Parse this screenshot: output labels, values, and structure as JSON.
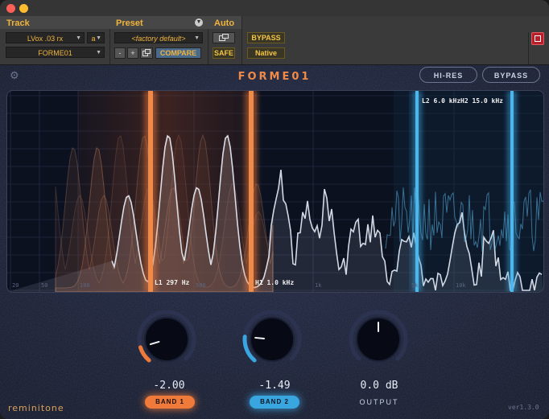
{
  "host": {
    "track_label": "Track",
    "track_name": "LVox .03 rx",
    "track_channel": "a",
    "plugin_instance": "FORME01",
    "preset_label": "Preset",
    "preset_name": "<factory default>",
    "minus_label": "-",
    "plus_label": "+",
    "compare_label": "COMPARE",
    "auto_label": "Auto",
    "safe_label": "SAFE",
    "bypass_label": "BYPASS",
    "native_label": "Native"
  },
  "plugin": {
    "title": "FORME01",
    "hires_label": "HI-RES",
    "bypass_label": "BYPASS",
    "brand": "reminitone",
    "version": "ver1.3.0"
  },
  "analyzer": {
    "freq_ticks": [
      "20",
      "50",
      "100",
      "500",
      "1k",
      "5k",
      "10k"
    ],
    "band_labels": {
      "l1": "L1 297 Hz",
      "h1": "H1 1.0 kHz",
      "l2": "L2 6.0 kHz",
      "h2": "H2 15.0 kHz"
    }
  },
  "knobs": {
    "band1": {
      "value": "-2.00",
      "label": "BAND 1",
      "level": -2.0
    },
    "band2": {
      "value": "-1.49",
      "label": "BAND 2",
      "level": -1.49
    },
    "output": {
      "value": "0.0 dB",
      "label": "OUTPUT",
      "level": 0.0
    }
  },
  "colors": {
    "band1": "#ef7a3a",
    "band2": "#3aa6e0",
    "accent": "#f0b43c"
  }
}
